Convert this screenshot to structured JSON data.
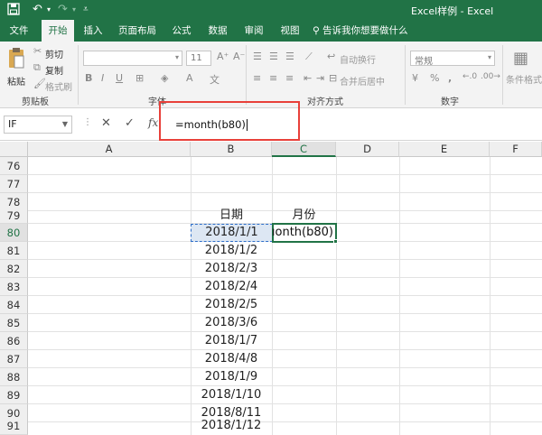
{
  "window": {
    "title": "Excel样例 - Excel",
    "save_icon": "save-icon",
    "undo_icon": "undo-icon",
    "redo_icon": "redo-icon",
    "customize_icon": "customize-qat-icon"
  },
  "tabs": [
    "文件",
    "开始",
    "插入",
    "页面布局",
    "公式",
    "数据",
    "审阅",
    "视图"
  ],
  "active_tab": "开始",
  "tell_me": "告诉我你想要做什么",
  "ribbon": {
    "clipboard": {
      "paste": "粘贴",
      "cut": "剪切",
      "copy": "复制",
      "format_painter": "格式刷",
      "label": "剪贴板"
    },
    "font": {
      "font_name": "",
      "font_size": "11",
      "label": "字体",
      "bold": "B",
      "italic": "I",
      "underline": "U"
    },
    "alignment": {
      "wrap": "自动换行",
      "merge": "合并后居中",
      "label": "对齐方式"
    },
    "number": {
      "format": "常规",
      "label": "数字",
      "percent": "%",
      "comma": ","
    },
    "styles": {
      "conditional": "条件格式"
    }
  },
  "formula_bar": {
    "name_box": "IF",
    "cancel": "✕",
    "enter": "✓",
    "fx": "fx",
    "formula": "=month(b80)"
  },
  "columns": [
    "A",
    "B",
    "C",
    "D",
    "E",
    "F"
  ],
  "active_column": "C",
  "rows": [
    {
      "num": "76",
      "b": "",
      "c": ""
    },
    {
      "num": "77",
      "b": "",
      "c": ""
    },
    {
      "num": "78",
      "b": "",
      "c": ""
    },
    {
      "num": "79",
      "b": "日期",
      "c": "月份"
    },
    {
      "num": "80",
      "b": "2018/1/1",
      "c": "ıonth(b80)"
    },
    {
      "num": "81",
      "b": "2018/1/2",
      "c": ""
    },
    {
      "num": "82",
      "b": "2018/2/3",
      "c": ""
    },
    {
      "num": "83",
      "b": "2018/2/4",
      "c": ""
    },
    {
      "num": "84",
      "b": "2018/2/5",
      "c": ""
    },
    {
      "num": "85",
      "b": "2018/3/6",
      "c": ""
    },
    {
      "num": "86",
      "b": "2018/1/7",
      "c": ""
    },
    {
      "num": "87",
      "b": "2018/4/8",
      "c": ""
    },
    {
      "num": "88",
      "b": "2018/1/9",
      "c": ""
    },
    {
      "num": "89",
      "b": "2018/1/10",
      "c": ""
    },
    {
      "num": "90",
      "b": "2018/8/11",
      "c": ""
    },
    {
      "num": "91",
      "b": "2018/1/12",
      "c": ""
    }
  ],
  "active_row": "80",
  "colors": {
    "accent": "#217346",
    "highlight": "#e8403a",
    "selection": "#dde7f3"
  }
}
